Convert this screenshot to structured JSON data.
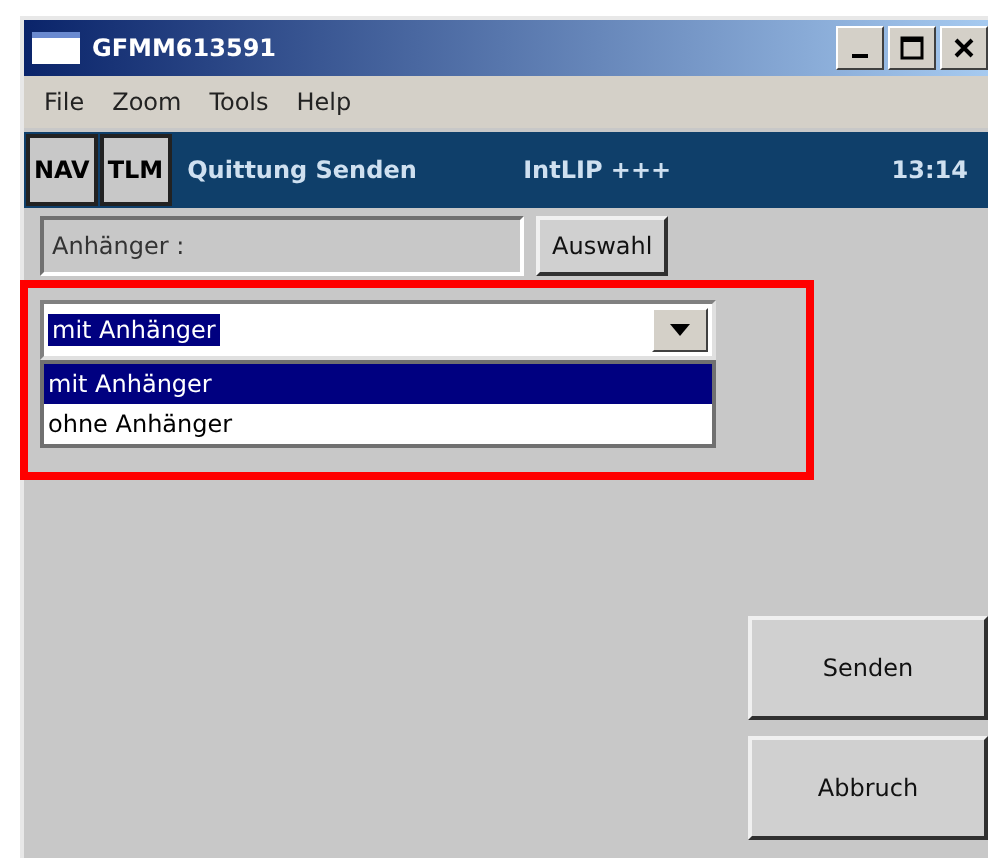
{
  "window": {
    "title": "GFMM613591"
  },
  "menu": [
    "File",
    "Zoom",
    "Tools",
    "Help"
  ],
  "nav": {
    "buttons": [
      "NAV",
      "TLM"
    ],
    "title": "Quittung Senden",
    "status": "IntLIP +++",
    "time": "13:14"
  },
  "trailer_field": {
    "value": "Anhänger :",
    "button": "Auswahl"
  },
  "dropdown": {
    "value": "mit Anhänger",
    "expanded": true,
    "options": [
      {
        "label": "mit Anhänger",
        "selected": true
      },
      {
        "label": "ohne Anhänger",
        "selected": false
      }
    ]
  },
  "buttons": [
    "Senden",
    "Abbruch"
  ]
}
